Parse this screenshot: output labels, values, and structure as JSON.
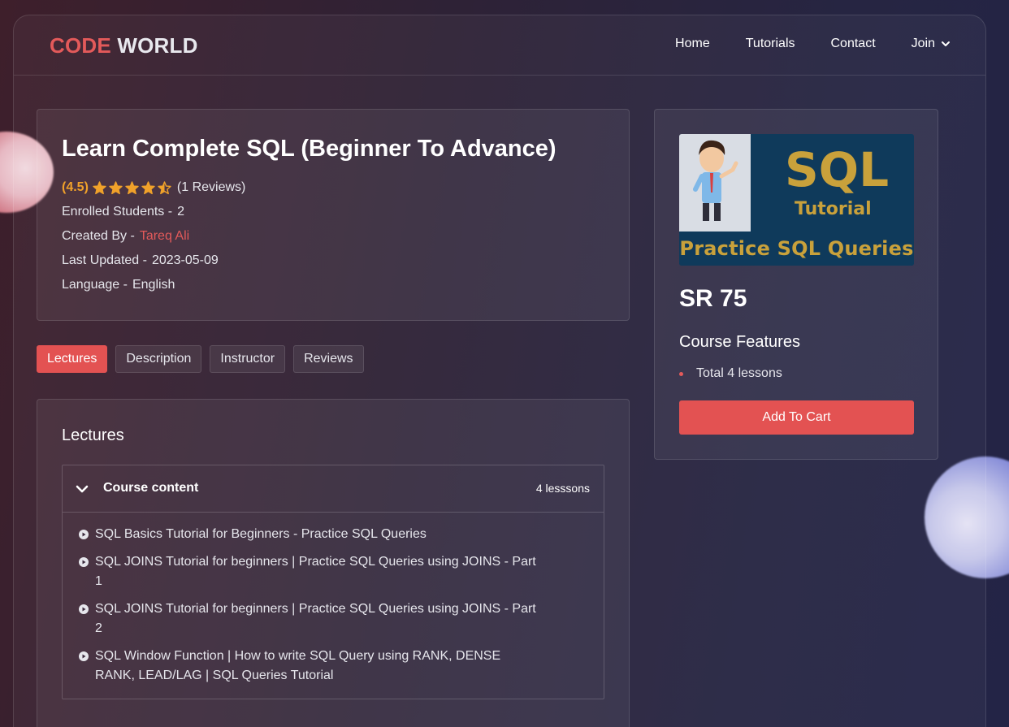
{
  "brand": {
    "part1": "CODE",
    "part2": "WORLD"
  },
  "nav": {
    "items": [
      {
        "label": "Home"
      },
      {
        "label": "Tutorials"
      },
      {
        "label": "Contact"
      },
      {
        "label": "Join"
      }
    ]
  },
  "course": {
    "title": "Learn Complete SQL (Beginner To Advance)",
    "rating_text": "(4.5)",
    "rating_value": 4.5,
    "rating_max": 5,
    "reviews_text": "(1 Reviews)",
    "enrolled_label": "Enrolled Students -",
    "enrolled_value": "2",
    "created_label": "Created By -",
    "created_value": "Tareq Ali",
    "updated_label": "Last Updated -",
    "updated_value": "2023-05-09",
    "language_label": "Language -",
    "language_value": "English"
  },
  "tabs": [
    {
      "label": "Lectures",
      "active": true
    },
    {
      "label": "Description",
      "active": false
    },
    {
      "label": "Instructor",
      "active": false
    },
    {
      "label": "Reviews",
      "active": false
    }
  ],
  "lectures": {
    "heading": "Lectures",
    "accordion_title": "Course content",
    "lesson_count": "4 lesssons",
    "items": [
      "SQL Basics Tutorial for Beginners - Practice SQL Queries",
      "SQL JOINS Tutorial for beginners | Practice SQL Queries using JOINS - Part 1",
      "SQL JOINS Tutorial for beginners | Practice SQL Queries using JOINS - Part 2",
      "SQL Window Function | How to write SQL Query using RANK, DENSE RANK, LEAD/LAG | SQL Queries Tutorial"
    ]
  },
  "sidebar": {
    "thumbnail": {
      "line1": "SQL",
      "line2": "Tutorial",
      "line3": "Practice SQL Queries"
    },
    "price": "SR 75",
    "features_title": "Course Features",
    "features": [
      "Total 4 lessons"
    ],
    "cart_label": "Add To Cart"
  },
  "colors": {
    "accent": "#e35252",
    "star": "#f0a12a",
    "thumb_bg": "#0f3a5b",
    "thumb_text": "#c9a13b"
  }
}
